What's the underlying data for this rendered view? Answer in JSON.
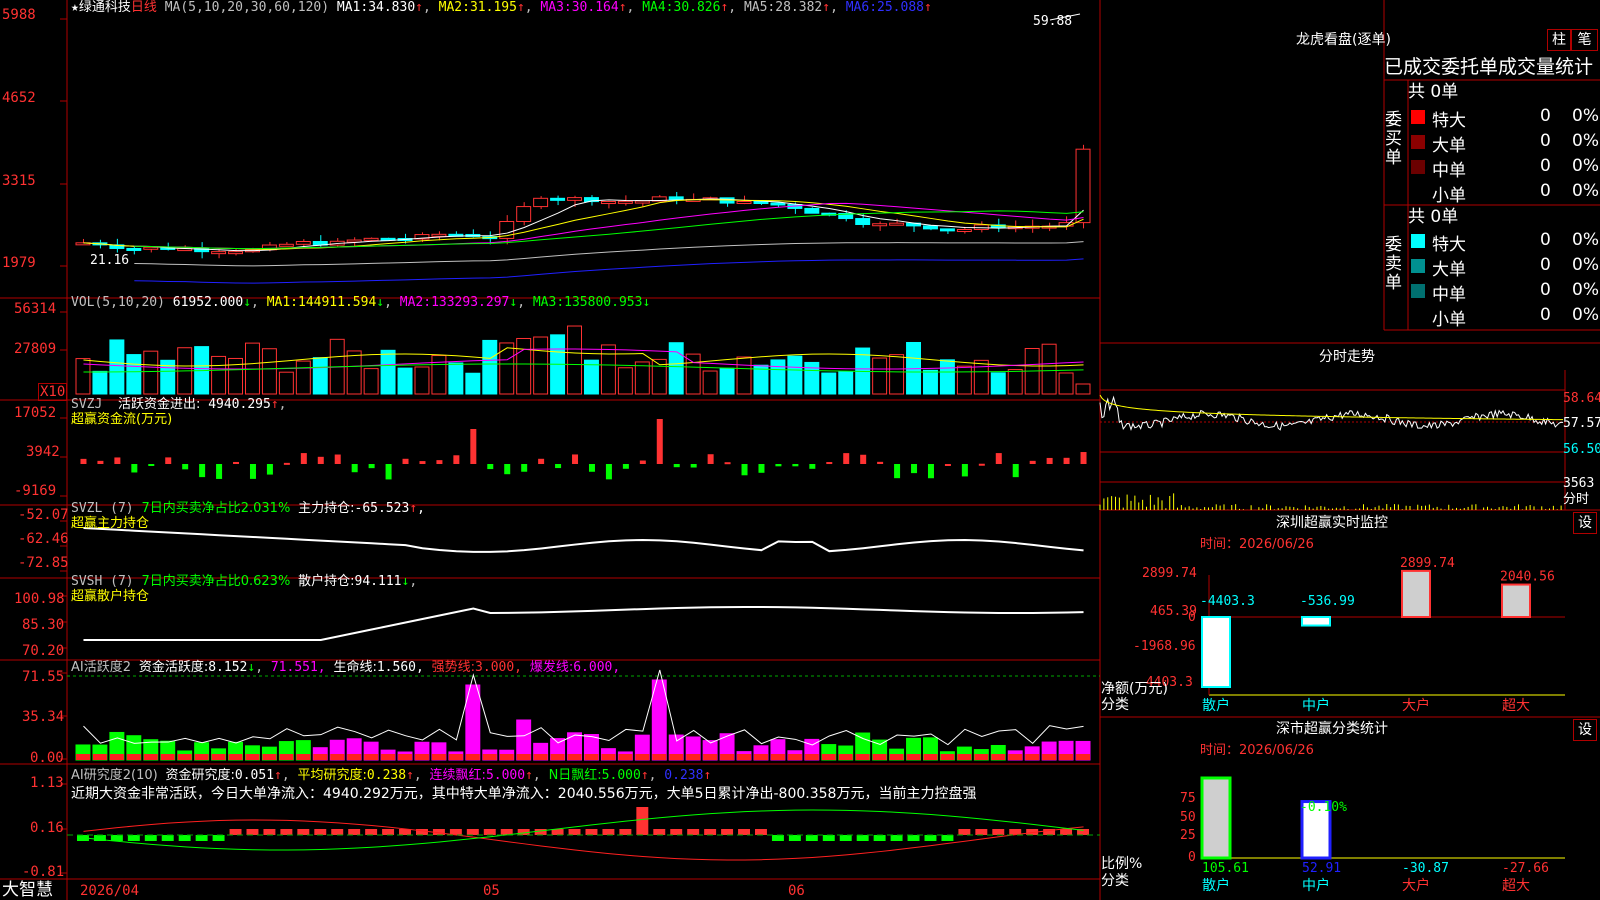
{
  "colors": {
    "up": "#ff3232",
    "down": "#00ffff",
    "grid": "#b00000",
    "ma1": "#ffffff",
    "ma2": "#ffff00",
    "ma3": "#ff00ff",
    "ma4": "#00ff00",
    "ma5": "#c0c0c0",
    "ma6": "#2020ff"
  },
  "kline": {
    "title_star": "★",
    "stock_name": "绿通科技",
    "period": "日线",
    "ma_params": "MA(5,10,20,30,60,120)",
    "ma": [
      {
        "label": "MA1:",
        "value": "34.830",
        "arrow": "↑"
      },
      {
        "label": "MA2:",
        "value": "31.195",
        "arrow": "↑"
      },
      {
        "label": "MA3:",
        "value": "30.164",
        "arrow": "↑"
      },
      {
        "label": "MA4:",
        "value": "30.826",
        "arrow": "↑"
      },
      {
        "label": "MA5:",
        "value": "28.382",
        "arrow": "↑"
      },
      {
        "label": "MA6:",
        "value": "25.088",
        "arrow": "↑"
      }
    ],
    "y_ticks": [
      "5988",
      "4652",
      "3315",
      "1979"
    ],
    "high_label": "59.88",
    "low_label": "21.16",
    "x_ticks": [
      "2026/04",
      "05",
      "06"
    ],
    "chart_data": {
      "type": "candlestick",
      "y_unit": "price",
      "bars": 60,
      "last_close": 59.88,
      "period_low": 21.16
    }
  },
  "vol": {
    "title": "VOL(5,10,20)",
    "value": "61952.000",
    "value_arrow": "↓",
    "ma": [
      {
        "label": "MA1:",
        "value": "144911.594",
        "arrow": "↓"
      },
      {
        "label": "MA2:",
        "value": "133293.297",
        "arrow": "↓"
      },
      {
        "label": "MA3:",
        "value": "135800.953",
        "arrow": "↓"
      }
    ],
    "y_ticks": [
      "56314",
      "27809"
    ],
    "scale": "X10"
  },
  "svzj": {
    "title": "SVZJ",
    "label": "活跃资金进出:",
    "value": "4940.295",
    "arrow": "↑",
    "subtitle": "超赢资金流(万元)",
    "y_ticks": [
      "17052",
      "3942",
      "-9169"
    ]
  },
  "svzl": {
    "title": "SVZL (7)",
    "ratio_label": "7日内买卖净占比2.031%",
    "label": "主力持仓:",
    "value": "-65.523",
    "arrow": "↑",
    "tail": ",",
    "subtitle": "超赢主力持仓",
    "y_ticks": [
      "-52.07",
      "-62.46",
      "-72.85"
    ]
  },
  "svsh": {
    "title": "SVSH (7)",
    "ratio_label": "7日内买卖净占比0.623%",
    "label": "散户持仓:",
    "value": "94.111",
    "arrow": "↓",
    "subtitle": "超赢散户持仓",
    "y_ticks": [
      "100.98",
      "85.30",
      "70.20"
    ]
  },
  "ai_active": {
    "title": "AI活跃度2",
    "label": "资金活跃度:",
    "value": "8.152",
    "arrow": "↓",
    "v2": "71.551,",
    "life_label": "生命线:",
    "life_value": "1.560,",
    "strong_label": "强势线:",
    "strong_value": "3.000,",
    "burst_label": "爆发线:",
    "burst_value": "6.000,",
    "y_ticks": [
      "71.55",
      "35.34",
      "0.00"
    ]
  },
  "ai_research": {
    "title": "AI研究度2(10)",
    "label": "资金研究度:",
    "value": "0.051",
    "arrow": "↑",
    "avg_label": "平均研究度:",
    "avg_value": "0.238",
    "avg_arrow": "↑",
    "cont_label": "连续飘红:",
    "cont_value": "5.000",
    "cont_arrow": "↑",
    "n_label": "N日飘红:",
    "n_value": "5.000",
    "n_arrow": "↑",
    "v_last": "0.238",
    "v_last_arrow": "↑",
    "summary": "近期大资金非常活跃，今日大单净流入：4940.292万元，其中特大单净流入：2040.556万元，大单5日累计净出-800.358万元，当前主力控盘强",
    "y_ticks": [
      "1.13",
      "0.16",
      "-0.81"
    ]
  },
  "footer": {
    "app_name": "大智慧"
  },
  "longhu": {
    "title": "龙虎看盘(逐单)",
    "btn_zhu": "柱",
    "btn_bi": "笔",
    "subtitle": "已成交委托单成交量统计",
    "buy_side": "委买单",
    "sell_side": "委卖单",
    "buy_total": "共 0单",
    "sell_total": "共 0单",
    "buy_rows": [
      {
        "name": "特大",
        "count": "0",
        "pct": "0%",
        "color": "#ff0000"
      },
      {
        "name": "大单",
        "count": "0",
        "pct": "0%",
        "color": "#8b0000"
      },
      {
        "name": "中单",
        "count": "0",
        "pct": "0%",
        "color": "#6b0000"
      },
      {
        "name": "小单",
        "count": "0",
        "pct": "0%",
        "color": "#000000"
      }
    ],
    "sell_rows": [
      {
        "name": "特大",
        "count": "0",
        "pct": "0%",
        "color": "#00ffff"
      },
      {
        "name": "大单",
        "count": "0",
        "pct": "0%",
        "color": "#009090"
      },
      {
        "name": "中单",
        "count": "0",
        "pct": "0%",
        "color": "#007070"
      },
      {
        "name": "小单",
        "count": "0",
        "pct": "0%",
        "color": "#000000"
      }
    ]
  },
  "timeshare": {
    "title": "分时走势",
    "p_high": "58.64",
    "p_mid": "57.57",
    "p_low": "56.50",
    "vol_label": "3563",
    "vol_unit": "分时"
  },
  "monitor": {
    "title": "深圳超赢实时监控",
    "set_label": "设",
    "time": "时间：2026/06/26",
    "y_ticks": [
      "2899.74",
      "465.39",
      "0",
      "-1968.96",
      "-4403.3"
    ],
    "y_axis_label": "净额(万元)",
    "x_axis_label": "分类",
    "chart_data": {
      "type": "bar",
      "categories": [
        "散户",
        "中户",
        "大户",
        "超大"
      ],
      "values": [
        -4403.3,
        -536.99,
        2899.74,
        2040.56
      ],
      "value_labels": [
        "-4403.3",
        "-536.99",
        "2899.74",
        "2040.56"
      ],
      "ylim": [
        -4403.3,
        2899.74
      ]
    }
  },
  "stats": {
    "title": "深市超赢分类统计",
    "set_label": "设",
    "time": "时间：2026/06/26",
    "y_ticks": [
      "75",
      "50",
      "25",
      "0"
    ],
    "y_axis_label": "比例%",
    "x_axis_label": "分类",
    "top_label": "-0.10%",
    "chart_data": {
      "type": "bar",
      "categories": [
        "散户",
        "中户",
        "大户",
        "超大"
      ],
      "values": [
        105.61,
        52.91,
        -30.87,
        -27.66
      ],
      "value_labels": [
        "105.61",
        "52.91",
        "-30.87",
        "-27.66"
      ],
      "ylim": [
        0,
        75
      ]
    }
  }
}
